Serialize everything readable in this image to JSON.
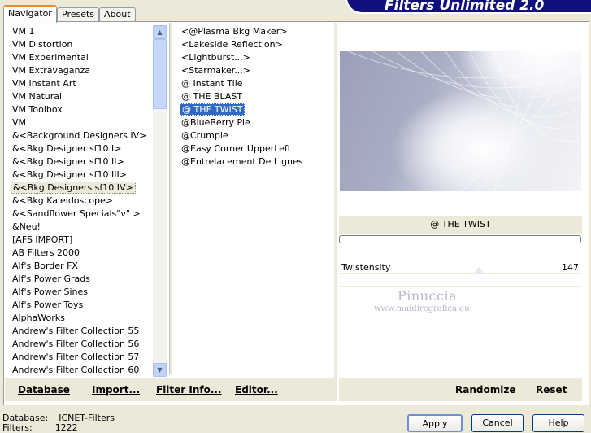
{
  "tabs": [
    "Navigator",
    "Presets",
    "About"
  ],
  "banner": "Filters Unlimited 2.0",
  "categories": [
    {
      "label": "VM 1"
    },
    {
      "label": "VM Distortion"
    },
    {
      "label": "VM Experimental"
    },
    {
      "label": "VM Extravaganza"
    },
    {
      "label": "VM Instant Art"
    },
    {
      "label": "VM Natural"
    },
    {
      "label": "VM Toolbox"
    },
    {
      "label": "VM"
    },
    {
      "label": "&<Background Designers IV>"
    },
    {
      "label": "&<Bkg Designer sf10 I>"
    },
    {
      "label": "&<Bkg Designer sf10 II>"
    },
    {
      "label": "&<Bkg Designer sf10 III>"
    },
    {
      "label": "&<Bkg Designers sf10 IV>",
      "selected": true
    },
    {
      "label": "&<Bkg Kaleidoscope>"
    },
    {
      "label": "&<Sandflower Specials\"v\" >"
    },
    {
      "label": "&Neu!"
    },
    {
      "label": "[AFS IMPORT]"
    },
    {
      "label": "AB Filters 2000"
    },
    {
      "label": "Alf's Border FX"
    },
    {
      "label": "Alf's Power Grads"
    },
    {
      "label": "Alf's Power Sines"
    },
    {
      "label": "Alf's Power Toys"
    },
    {
      "label": "AlphaWorks"
    },
    {
      "label": "Andrew's Filter Collection 55"
    },
    {
      "label": "Andrew's Filter Collection 56"
    },
    {
      "label": "Andrew's Filter Collection 57"
    },
    {
      "label": "Andrew's Filter Collection 60"
    }
  ],
  "filters": [
    {
      "label": "<@Plasma Bkg Maker>"
    },
    {
      "label": "<Lakeside Reflection>"
    },
    {
      "label": "<Lightburst...>"
    },
    {
      "label": "<Starmaker...>"
    },
    {
      "label": "@ Instant Tile"
    },
    {
      "label": "@ THE BLAST"
    },
    {
      "label": "@ THE TWIST",
      "selected": true
    },
    {
      "label": "@BlueBerry Pie"
    },
    {
      "label": "@Crumple"
    },
    {
      "label": "@Easy Corner UpperLeft"
    },
    {
      "label": "@Entrelacement De Lignes"
    }
  ],
  "selected_filter_title": "@ THE TWIST",
  "params": [
    {
      "label": "Twistensity",
      "value": "147"
    }
  ],
  "watermark": {
    "name": "Pinuccia",
    "url": "www.maidiregrafica.eu"
  },
  "toolbar": {
    "database": "Database",
    "import": "Import...",
    "filter_info": "Filter Info...",
    "editor": "Editor...",
    "randomize": "Randomize",
    "reset": "Reset"
  },
  "status": {
    "database_label": "Database:",
    "database_value": "ICNET-Filters",
    "filters_label": "Filters:",
    "filters_value": "1222"
  },
  "buttons": {
    "apply": "Apply",
    "cancel": "Cancel",
    "help": "Help"
  },
  "colors": {
    "selection": "#316ac5",
    "banner": "#10107e"
  }
}
